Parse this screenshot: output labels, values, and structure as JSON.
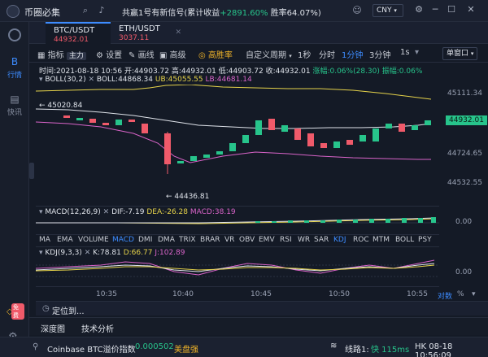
{
  "titlebar": {
    "app_name": "币圈必集",
    "ticker_label": "共赢1号有新信号(累计收益",
    "ticker_gain": "+2891.60%",
    "ticker_winrate": "胜率64.07%)",
    "currency": "CNY"
  },
  "sidebar": {
    "items": [
      {
        "label": "行情",
        "icon": "candlestick-icon"
      },
      {
        "label": "快讯",
        "icon": "news-icon"
      }
    ],
    "badge": "免费"
  },
  "symbol_tabs": [
    {
      "name": "BTC/USDT",
      "price": "44932.01",
      "price_color": "#f05a6a",
      "active": true
    },
    {
      "name": "ETH/USDT",
      "price": "3037.11",
      "price_color": "#f05a6a",
      "active": false
    }
  ],
  "toolbar": {
    "indicator": "指标",
    "main_chart": "主力",
    "settings": "设置",
    "draw": "画线",
    "advanced": "高级",
    "win_rate": "高胜率",
    "custom_period": "自定义周期",
    "periods": [
      "1秒",
      "分时",
      "1分钟",
      "3分钟",
      "1s"
    ],
    "active_period": "1分钟",
    "window_mode": "单窗口"
  },
  "ohlc": {
    "time": "时间:2021-08-18 10:56",
    "open": "开:44903.72",
    "high": "高:44932.01",
    "low": "低:44903.72",
    "close": "收:44932.01",
    "change": "涨幅:0.06%(28.30)",
    "amplitude": "振幅:0.06%"
  },
  "boll": {
    "label": "BOLL(30,2)",
    "value": "BOLL:44868.34",
    "ub": "UB:45055.55",
    "lb": "LB:44681.14"
  },
  "annotations": {
    "high_mark": "← 45020.84",
    "low_mark": "← 44436.81"
  },
  "price_axis": {
    "ticks": [
      "45111.34",
      "44724.65",
      "44532.55"
    ],
    "current": "44932.01",
    "macd_tick": "0.00",
    "kdj_tick": "0.00"
  },
  "macd": {
    "label": "MACD(12,26,9)",
    "dif": "DIF:-7.19",
    "dea": "DEA:-26.28",
    "macd": "MACD:38.19"
  },
  "indicator_tabs": [
    "MA",
    "EMA",
    "VOLUME",
    "MACD",
    "DMI",
    "DMA",
    "TRIX",
    "BRAR",
    "VR",
    "OBV",
    "EMV",
    "RSI",
    "WR",
    "SAR",
    "KDJ",
    "ROC",
    "MTM",
    "BOLL",
    "PSY"
  ],
  "active_indicator_tabs": [
    "MACD",
    "KDJ"
  ],
  "kdj": {
    "label": "KDJ(9,3,3)",
    "k": "K:78.81",
    "d": "D:66.77",
    "j": "J:102.89"
  },
  "time_axis": [
    "10:35",
    "10:40",
    "10:45",
    "10:50",
    "10:55"
  ],
  "axis_options": [
    "对数",
    "%"
  ],
  "locate": "定位到...",
  "bottom_tabs": [
    "深度图",
    "技术分析"
  ],
  "statusbar": {
    "index_label": "Coinbase BTC溢价指数",
    "index_value": "0.000502",
    "index_tag": "美盘强",
    "line": "线路1:",
    "latency": "快 115ms",
    "clock": "HK 08-18 10:56:09"
  },
  "colors": {
    "up": "#27c48b",
    "down": "#f05a6a",
    "accent": "#3d8cff",
    "highlight": "#f0b429"
  }
}
